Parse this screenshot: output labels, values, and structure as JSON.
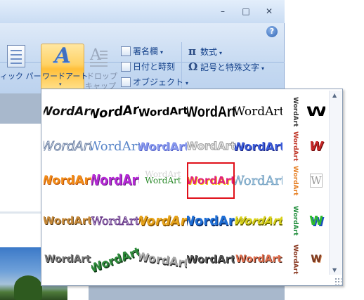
{
  "window": {
    "minimize_glyph": "–",
    "maximize_glyph": "□",
    "close_glyph": "✕",
    "help_glyph": "?"
  },
  "ribbon": {
    "left_partial_label": "ィック パーツ",
    "wordart_label": "ワードアート",
    "dropcap_label_1": "ドロップ",
    "dropcap_label_2": "キャップ",
    "signature_line": "署名欄",
    "date_time": "日付と時刻",
    "object": "オブジェクト",
    "equation": "数式",
    "symbol": "記号と特殊文字",
    "caret": "▾"
  },
  "gallery": {
    "sample_text": "WordArt",
    "narrow_sample": "W",
    "vertical_sample": "WordArt",
    "selected_index": 13,
    "scroll_up": "▲",
    "scroll_down": "▼"
  },
  "colors": {
    "ribbon_bg": "#c5d9f1",
    "wordart_button_highlight": "#ffd265",
    "selection_border": "#e0101a",
    "text_blue": "#15428b"
  }
}
